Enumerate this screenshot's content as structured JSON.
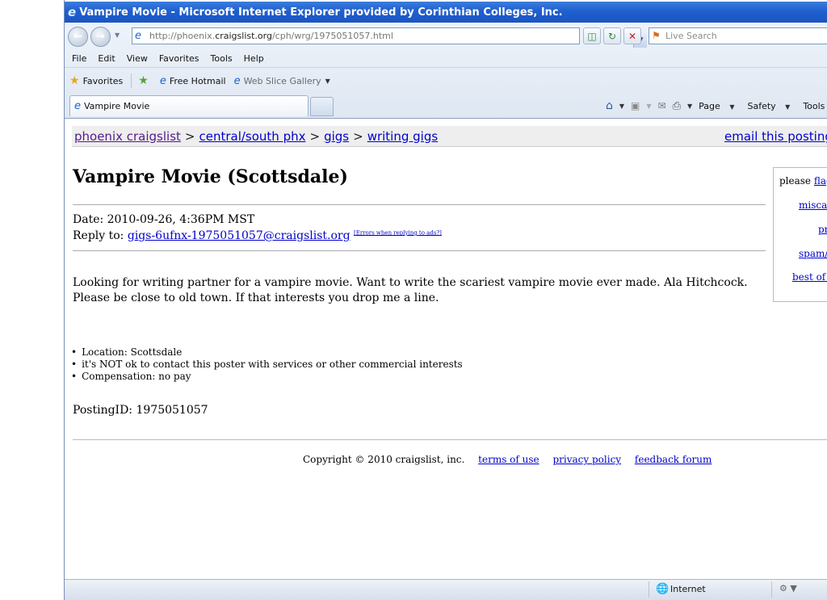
{
  "window": {
    "title": "Vampire Movie - Microsoft Internet Explorer provided by Corinthian Colleges, Inc."
  },
  "navbar": {
    "url_prefix": "http://phoenix.",
    "url_host": "craigslist.org",
    "url_path": "/cph/wrg/1975051057.html",
    "search_placeholder": "Live Search"
  },
  "menubar": {
    "items": [
      "File",
      "Edit",
      "View",
      "Favorites",
      "Tools",
      "Help"
    ]
  },
  "favorites_bar": {
    "favorites_label": "Favorites",
    "items": [
      "Free Hotmail",
      "Web Slice Gallery"
    ]
  },
  "tabs": {
    "active_label": "Vampire Movie"
  },
  "command_bar": {
    "page_label": "Page",
    "safety_label": "Safety",
    "tools_label": "Tools"
  },
  "breadcrumb": {
    "items": [
      "phoenix craigslist",
      "central/south phx",
      "gigs",
      "writing gigs"
    ],
    "separator": ">",
    "email_link": "email this posting to a friend"
  },
  "posting": {
    "title": "Vampire Movie (Scottsdale)",
    "date": "Date: 2010-09-26, 4:36PM MST",
    "reply_label": "Reply to:",
    "reply_email": "gigs-6ufnx-1975051057@craigslist.org",
    "reply_errors": "[Errors when replying to ads?]",
    "body": "Looking for writing partner for a vampire movie. Want to write the scariest vampire movie ever made. Ala Hitchcock. Please be close to old town. If that interests you drop me a line.",
    "bullets": [
      "Location: Scottsdale",
      "it's NOT ok to contact this poster with services or other commercial interests",
      "Compensation: no pay"
    ],
    "posting_id": "PostingID: 1975051057"
  },
  "flag_box": {
    "prompt": "please",
    "flag_link": "flag",
    "items": [
      "miscategorized",
      "prohibited",
      "spam/overpost",
      "best of craigslist"
    ]
  },
  "footer": {
    "copyright": "Copyright © 2010 craigslist, inc.",
    "links": [
      "terms of use",
      "privacy policy",
      "feedback forum"
    ]
  },
  "statusbar": {
    "zone": "Internet"
  }
}
